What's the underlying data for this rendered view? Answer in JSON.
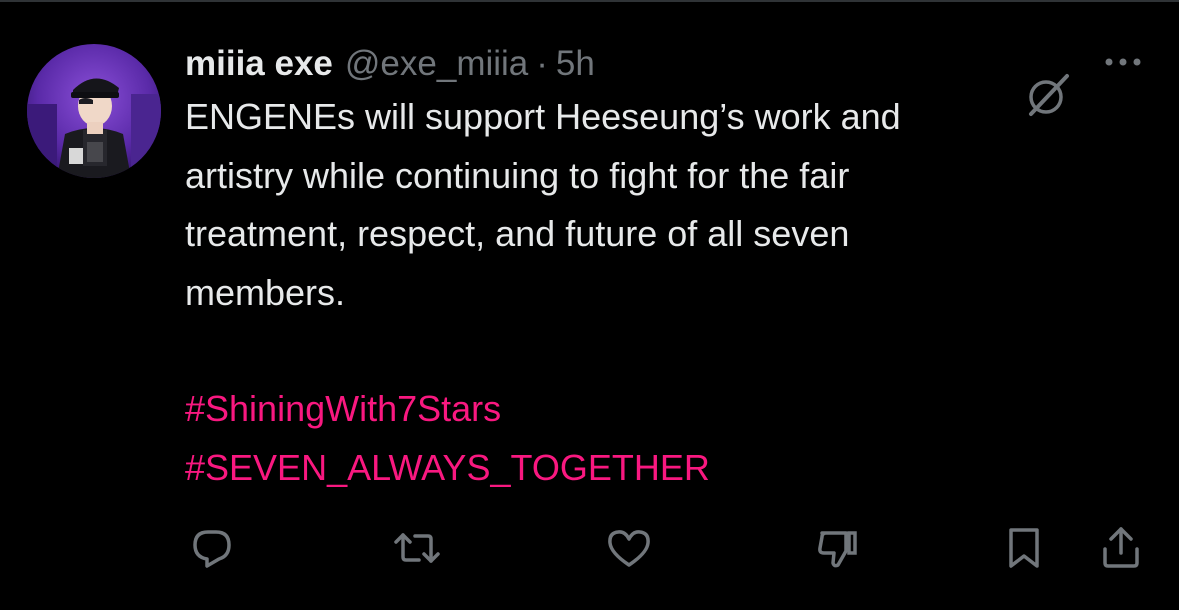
{
  "tweet": {
    "author": {
      "display_name": "miiia exe",
      "handle": "@exe_miiia",
      "avatar": "avatar"
    },
    "separator": "·",
    "time": "5h",
    "text_lines": [
      "ENGENEs will support Heeseung’s work and",
      "artistry while continuing to fight for the fair",
      "treatment, respect, and future of all seven",
      "members."
    ],
    "hashtags": [
      "#ShiningWith7Stars",
      "#SEVEN_ALWAYS_TOGETHER"
    ]
  },
  "icons": {
    "grok": "grok-icon",
    "more": "more-icon",
    "reply": "reply-icon",
    "repost": "repost-icon",
    "like": "like-icon",
    "dislike": "dislike-icon",
    "bookmark": "bookmark-icon",
    "share": "share-icon"
  },
  "colors": {
    "background": "#000000",
    "text": "#e7e9ea",
    "secondary": "#71767b",
    "hashtag": "#f91880"
  }
}
